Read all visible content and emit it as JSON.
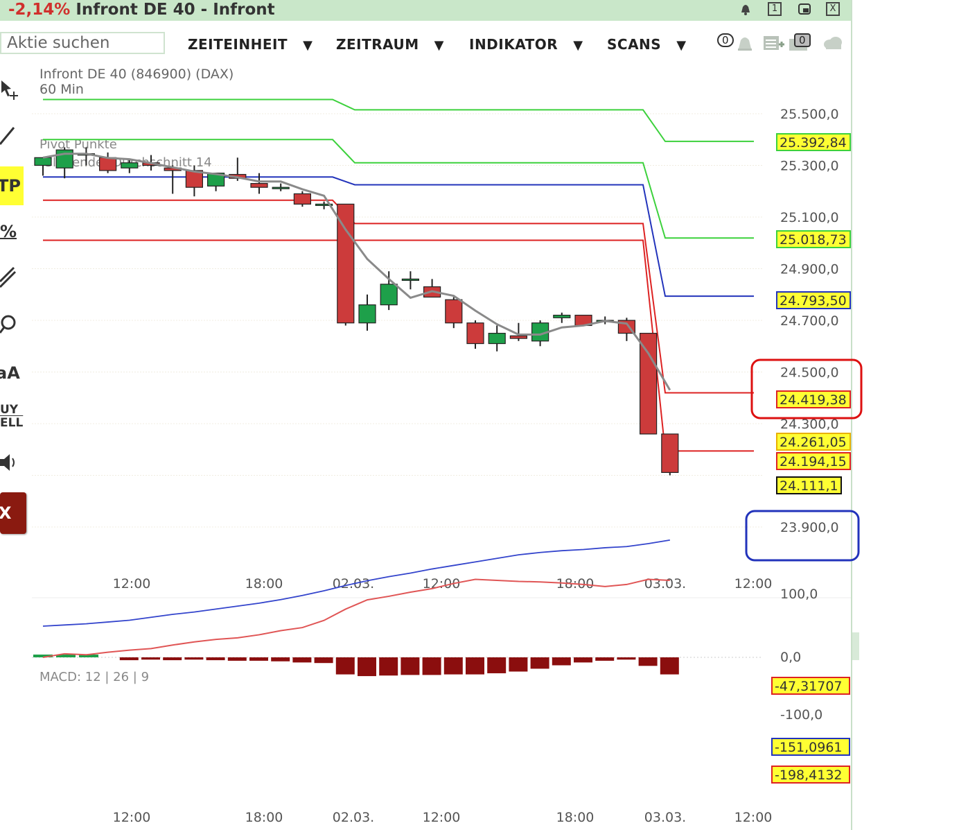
{
  "window": {
    "change_pct": "-2,14%",
    "title": "Infront DE 40 - Infront",
    "icons": [
      "bell-icon",
      "window-1-icon",
      "restore-icon",
      "close-icon"
    ],
    "restore_label": "1",
    "close_label": "X"
  },
  "toolbar": {
    "search_placeholder": "Aktie suchen",
    "menus": [
      "ZEITEINHEIT",
      "ZEITRAUM",
      "INDIKATOR",
      "SCANS"
    ],
    "dropdown_glyph": "▼",
    "alert_count": "0",
    "folder_count": "0"
  },
  "left_tools": {
    "tp_label": "TP",
    "pct_label": "%",
    "font_label": "aA",
    "buy_label": "UY",
    "sell_label": "ELL",
    "exit_label": "X"
  },
  "chart": {
    "instrument": "Infront DE 40 (846900) (DAX)",
    "interval": "60 Min",
    "pivot_label": "Pivot Punkte",
    "ma_label": "Gleitender Durchschnitt 14",
    "macd_label": "MACD: 12 | 26 | 9",
    "price_axis": [
      "25.500,0",
      "25.300,0",
      "25.100,0",
      "24.900,0",
      "24.700,0",
      "24.500,0",
      "24.300,0",
      "23.900,0"
    ],
    "macd_axis": [
      "100,0",
      "0,0",
      "-100,0"
    ],
    "time_axis": [
      "12:00",
      "18:00",
      "02.03.",
      "12:00",
      "18:00",
      "03.03.",
      "12:00"
    ],
    "level_tags": [
      {
        "value": "25.392,84",
        "color": "#3cd13c"
      },
      {
        "value": "25.018,73",
        "color": "#3cd13c"
      },
      {
        "value": "24.793,50",
        "color": "#2233bb"
      },
      {
        "value": "24.419,38",
        "color": "#dd2222"
      },
      {
        "value": "24.261,05",
        "color": "#e8b000"
      },
      {
        "value": "24.194,15",
        "color": "#dd2222"
      },
      {
        "value": "24.111,1",
        "color": "#111111"
      }
    ],
    "macd_tags": [
      {
        "value": "-47,31707",
        "color": "#dd2222"
      },
      {
        "value": "-151,0961",
        "color": "#2233bb"
      },
      {
        "value": "-198,4132",
        "color": "#dd2222"
      }
    ],
    "colors": {
      "up": "#1ea04a",
      "down": "#cc3b3b",
      "ma": "#8a8a8a",
      "macd_hist": "#8b0e0e",
      "highlight_red": "#dd1111",
      "highlight_blue": "#2233bb"
    }
  },
  "chart_data": {
    "type": "candlestick",
    "interval": "60 Min",
    "candles": [
      {
        "o": 25300,
        "h": 25330,
        "l": 25260,
        "c": 25330
      },
      {
        "o": 25290,
        "h": 25370,
        "l": 25250,
        "c": 25360
      },
      {
        "o": 25340,
        "h": 25370,
        "l": 25300,
        "c": 25345
      },
      {
        "o": 25330,
        "h": 25350,
        "l": 25270,
        "c": 25280
      },
      {
        "o": 25290,
        "h": 25320,
        "l": 25270,
        "c": 25310
      },
      {
        "o": 25310,
        "h": 25340,
        "l": 25280,
        "c": 25300
      },
      {
        "o": 25290,
        "h": 25300,
        "l": 25190,
        "c": 25280
      },
      {
        "o": 25280,
        "h": 25300,
        "l": 25180,
        "c": 25215
      },
      {
        "o": 25220,
        "h": 25270,
        "l": 25200,
        "c": 25270
      },
      {
        "o": 25265,
        "h": 25330,
        "l": 25240,
        "c": 25250
      },
      {
        "o": 25230,
        "h": 25270,
        "l": 25190,
        "c": 25215
      },
      {
        "o": 25215,
        "h": 25230,
        "l": 25200,
        "c": 25215
      },
      {
        "o": 25190,
        "h": 25200,
        "l": 25140,
        "c": 25150
      },
      {
        "o": 25150,
        "h": 25160,
        "l": 25130,
        "c": 25150
      },
      {
        "o": 25150,
        "h": 25150,
        "l": 24680,
        "c": 24690
      },
      {
        "o": 24690,
        "h": 24800,
        "l": 24660,
        "c": 24760
      },
      {
        "o": 24760,
        "h": 24890,
        "l": 24740,
        "c": 24840
      },
      {
        "o": 24860,
        "h": 24890,
        "l": 24820,
        "c": 24860
      },
      {
        "o": 24830,
        "h": 24860,
        "l": 24790,
        "c": 24790
      },
      {
        "o": 24780,
        "h": 24790,
        "l": 24670,
        "c": 24690
      },
      {
        "o": 24690,
        "h": 24700,
        "l": 24590,
        "c": 24610
      },
      {
        "o": 24610,
        "h": 24680,
        "l": 24580,
        "c": 24650
      },
      {
        "o": 24640,
        "h": 24690,
        "l": 24620,
        "c": 24630
      },
      {
        "o": 24620,
        "h": 24700,
        "l": 24600,
        "c": 24690
      },
      {
        "o": 24710,
        "h": 24730,
        "l": 24690,
        "c": 24720
      },
      {
        "o": 24720,
        "h": 24720,
        "l": 24680,
        "c": 24680
      },
      {
        "o": 24695,
        "h": 24715,
        "l": 24685,
        "c": 24700
      },
      {
        "o": 24700,
        "h": 24710,
        "l": 24620,
        "c": 24650
      },
      {
        "o": 24650,
        "h": 24650,
        "l": 24260,
        "c": 24260
      },
      {
        "o": 24260,
        "h": 24261,
        "l": 24100,
        "c": 24111
      }
    ],
    "macd_histogram": [
      -5,
      -5,
      -5,
      -5,
      -5,
      -4,
      -5,
      -4,
      -5,
      -6,
      -6,
      -7,
      -9,
      -10,
      -30,
      -33,
      -32,
      -31,
      -31,
      -30,
      -30,
      -28,
      -25,
      -20,
      -14,
      -9,
      -6,
      -4,
      -15,
      -30
    ],
    "price_axis_range": [
      23800,
      25600
    ],
    "macd_axis_range": [
      -230,
      105
    ],
    "pivot_levels": [
      25392.84,
      25018.73,
      24793.5,
      24419.38,
      24194.15
    ]
  }
}
